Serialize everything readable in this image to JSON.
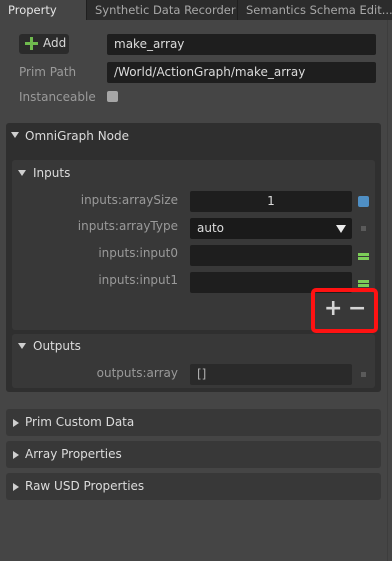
{
  "tabs": [
    {
      "label": "Property",
      "active": true
    },
    {
      "label": "Synthetic Data Recorder",
      "active": false
    },
    {
      "label": "Semantics Schema Edit...",
      "active": false
    }
  ],
  "header": {
    "add_label": "Add",
    "name_value": "make_array",
    "prim_path_label": "Prim Path",
    "prim_path_value": "/World/ActionGraph/make_array",
    "instanceable_label": "Instanceable"
  },
  "omnigraph": {
    "title": "OmniGraph Node",
    "inputs": {
      "title": "Inputs",
      "rows": [
        {
          "label": "inputs:arraySize",
          "value": "1"
        },
        {
          "label": "inputs:arrayType",
          "value": "auto"
        },
        {
          "label": "inputs:input0",
          "value": ""
        },
        {
          "label": "inputs:input1",
          "value": ""
        }
      ]
    },
    "outputs": {
      "title": "Outputs",
      "rows": [
        {
          "label": "outputs:array",
          "value": "[]"
        }
      ]
    },
    "add_symbol": "+",
    "remove_symbol": "−"
  },
  "collapsed_sections": [
    {
      "label": "Prim Custom Data"
    },
    {
      "label": "Array Properties"
    },
    {
      "label": "Raw USD Properties"
    }
  ],
  "colors": {
    "highlight": "#ff1212",
    "add_icon": "#6fba4e",
    "connect_icon": "#7ccd58",
    "array_size_icon": "#4f8fc4"
  }
}
